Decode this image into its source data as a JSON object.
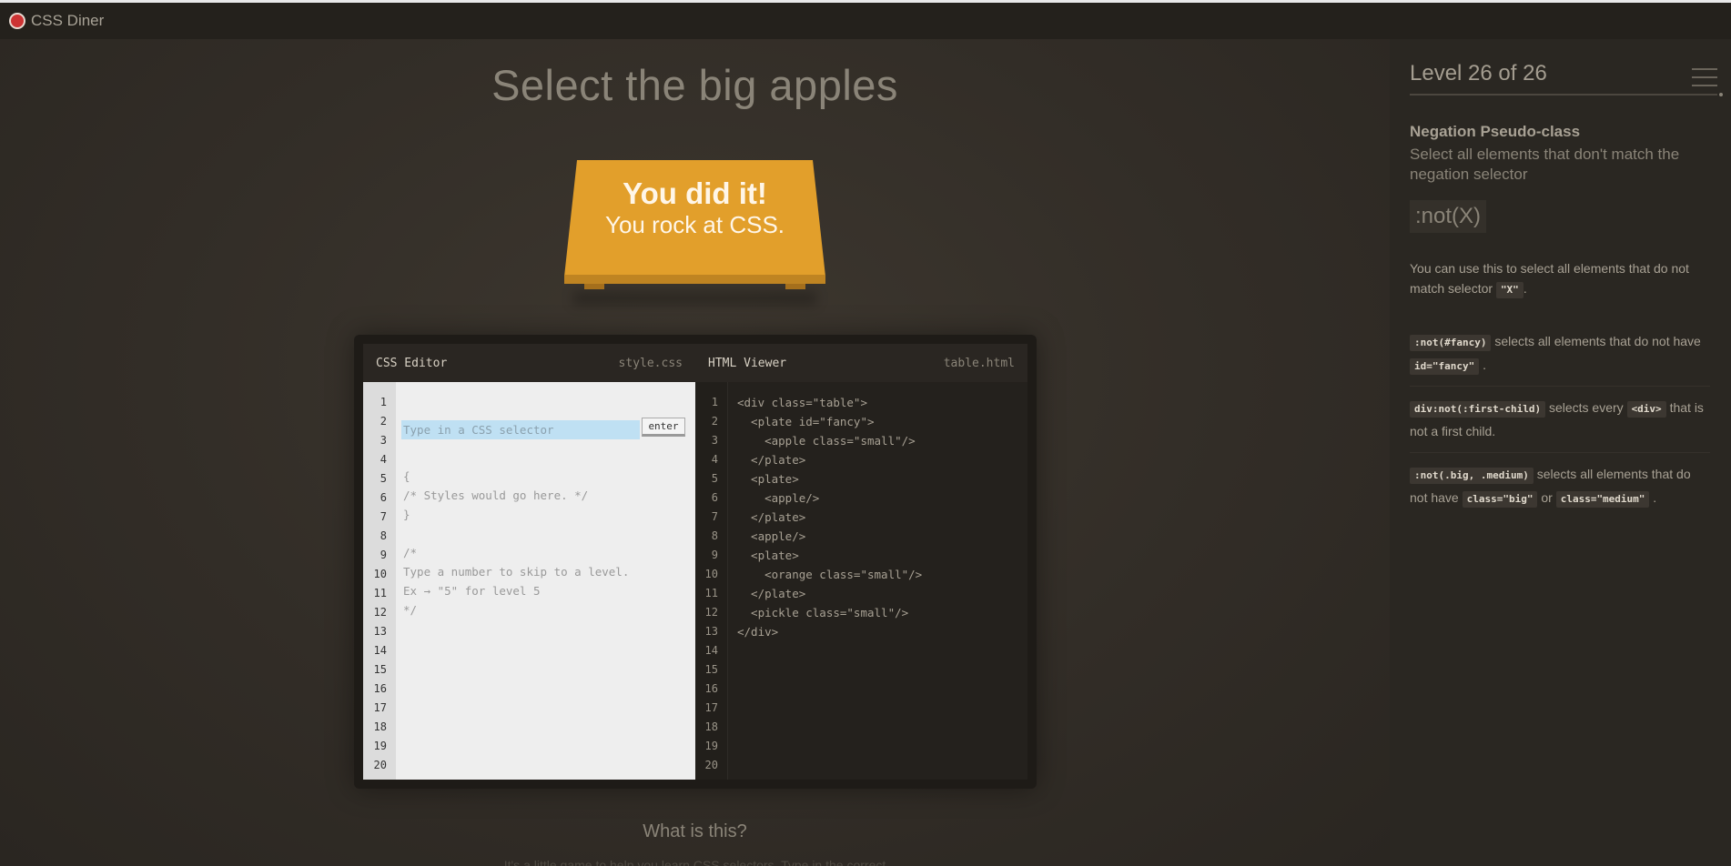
{
  "app": {
    "title": "CSS Diner"
  },
  "main": {
    "level_title": "Select the big apples",
    "win_line1": "You did it!",
    "win_line2": "You rock at CSS.",
    "what_title": "What is this?",
    "what_text": "It's a little game to help you learn CSS selectors. Type in the correct"
  },
  "editor": {
    "css_title": "CSS Editor",
    "css_file": "style.css",
    "html_title": "HTML Viewer",
    "html_file": "table.html",
    "input_placeholder": "Type in a CSS selector",
    "enter_label": "enter",
    "css_lines": [
      "{",
      "/* Styles would go here. */",
      "}",
      "",
      "/*",
      "Type a number to skip to a level.",
      "Ex → \"5\" for level 5",
      "*/"
    ],
    "html_lines": [
      "<div class=\"table\">",
      "  <plate id=\"fancy\">",
      "    <apple class=\"small\"/>",
      "  </plate>",
      "  <plate>",
      "    <apple/>",
      "  </plate>",
      "  <apple/>",
      "  <plate>",
      "    <orange class=\"small\"/>",
      "  </plate>",
      "  <pickle class=\"small\"/>",
      "</div>"
    ],
    "line_numbers": [
      "1",
      "2",
      "3",
      "4",
      "5",
      "6",
      "7",
      "8",
      "9",
      "10",
      "11",
      "12",
      "13",
      "14",
      "15",
      "16",
      "17",
      "18",
      "19",
      "20"
    ]
  },
  "sidebar": {
    "level_label": "Level 26 of 26",
    "selector_name": "Negation Pseudo-class",
    "selector_desc": "Select all elements that don't match the negation selector",
    "syntax": ":not(X)",
    "help_before": "You can use this to select all elements that do not match selector ",
    "help_code": "\"X\"",
    "help_after": ".",
    "examples": [
      {
        "code": ":not(#fancy)",
        "text1": " selects all elements that do not have ",
        "code2": "id=\"fancy\"",
        "text2": " ."
      },
      {
        "code": "div:not(:first-child)",
        "text1": " selects every ",
        "code2": "<div>",
        "text2": " that is not a first child."
      },
      {
        "code": ":not(.big, .medium)",
        "text1": " selects all elements that do not have ",
        "code2": "class=\"big\"",
        "text2": " or ",
        "code3": "class=\"medium\"",
        "text3": " ."
      }
    ]
  }
}
